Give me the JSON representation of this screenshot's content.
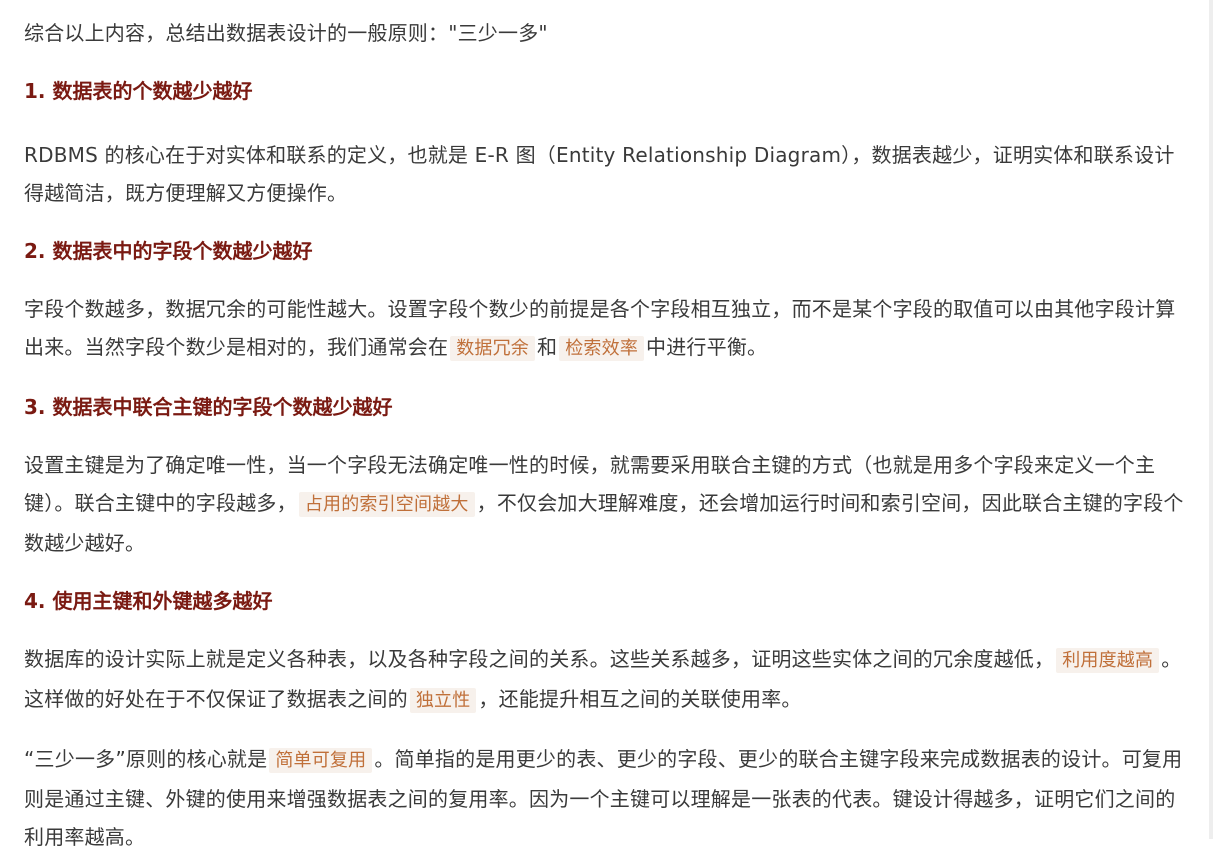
{
  "intro": "综合以上内容，总结出数据表设计的一般原则：\"三少一多\"",
  "sections": [
    {
      "heading": "1. 数据表的个数越少越好",
      "text": "RDBMS 的核心在于对实体和联系的定义，也就是 E-R 图（Entity Relationship Diagram），数据表越少，证明实体和联系设计得越简洁，既方便理解又方便操作。"
    },
    {
      "heading": "2. 数据表中的字段个数越少越好",
      "parts": [
        "字段个数越多，数据冗余的可能性越大。设置字段个数少的前提是各个字段相互独立，而不是某个字段的取值可以由其他字段计算出来。当然字段个数少是相对的，我们通常会在",
        "数据冗余",
        "和",
        "检索效率",
        "中进行平衡。"
      ]
    },
    {
      "heading": "3. 数据表中联合主键的字段个数越少越好",
      "parts": [
        "设置主键是为了确定唯一性，当一个字段无法确定唯一性的时候，就需要采用联合主键的方式（也就是用多个字段来定义一个主键）。联合主键中的字段越多，",
        "占用的索引空间越大",
        "，不仅会加大理解难度，还会增加运行时间和索引空间，因此联合主键的字段个数越少越好。"
      ]
    },
    {
      "heading": "4. 使用主键和外键越多越好",
      "parts": [
        "数据库的设计实际上就是定义各种表，以及各种字段之间的关系。这些关系越多，证明这些实体之间的冗余度越低，",
        "利用度越高",
        "。这样做的好处在于不仅保证了数据表之间的",
        "独立性",
        "，还能提升相互之间的关联使用率。"
      ]
    }
  ],
  "conclusion": {
    "parts": [
      "“三少一多”原则的核心就是",
      "简单可复用",
      "。简单指的是用更少的表、更少的字段、更少的联合主键字段来完成数据表的设计。可复用则是通过主键、外键的使用来增强数据表之间的复用率。因为一个主键可以理解是一张表的代表。键设计得越多，证明它们之间的利用率越高。"
    ]
  },
  "colors": {
    "heading": "#7a1a12",
    "code_text": "#c0703a",
    "code_bg": "#f7f1ec"
  }
}
